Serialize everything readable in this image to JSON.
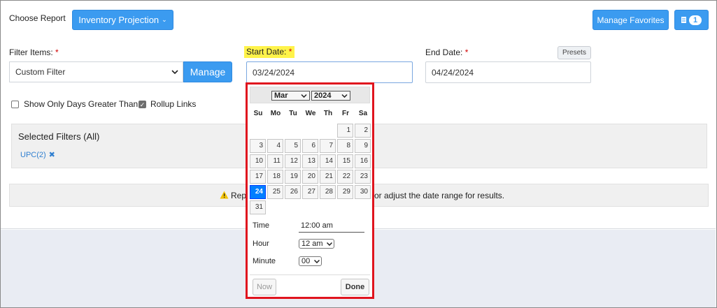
{
  "header": {
    "choose_report_label": "Choose Report",
    "report_button": "Inventory Projection",
    "manage_favorites": "Manage Favorites",
    "badge_count": "1"
  },
  "filter_items": {
    "label": "Filter Items:",
    "required_mark": "*",
    "select_value": "Custom Filter",
    "manage_button": "Manage"
  },
  "start_date": {
    "label": "Start Date:",
    "required_mark": "*",
    "value": "03/24/2024"
  },
  "end_date": {
    "label": "End Date:",
    "required_mark": "*",
    "value": "04/24/2024",
    "presets_button": "Presets"
  },
  "options": {
    "show_only_days": "Show Only Days Greater Than",
    "show_only_days_checked": false,
    "rollup_links": "Rollup Links",
    "rollup_links_checked": true
  },
  "selected_filters": {
    "title": "Selected Filters (All)",
    "tags": [
      "UPC(2)"
    ]
  },
  "notice": {
    "text_left": "Rep",
    "text_right": "or adjust the date range for results."
  },
  "datepicker": {
    "month": "Mar",
    "year": "2024",
    "weekdays": [
      "Su",
      "Mo",
      "Tu",
      "We",
      "Th",
      "Fr",
      "Sa"
    ],
    "first_weekday_index": 5,
    "days_in_month": 31,
    "selected_day": 24,
    "time_label": "Time",
    "time_value": "12:00 am",
    "hour_label": "Hour",
    "hour_value": "12 am",
    "minute_label": "Minute",
    "minute_value": "00",
    "now_button": "Now",
    "done_button": "Done"
  },
  "colors": {
    "primary": "#3b9bf0",
    "required": "#d00000",
    "highlight": "#fff34a",
    "picker_outline": "#e0141e",
    "selected_day": "#007fff"
  }
}
